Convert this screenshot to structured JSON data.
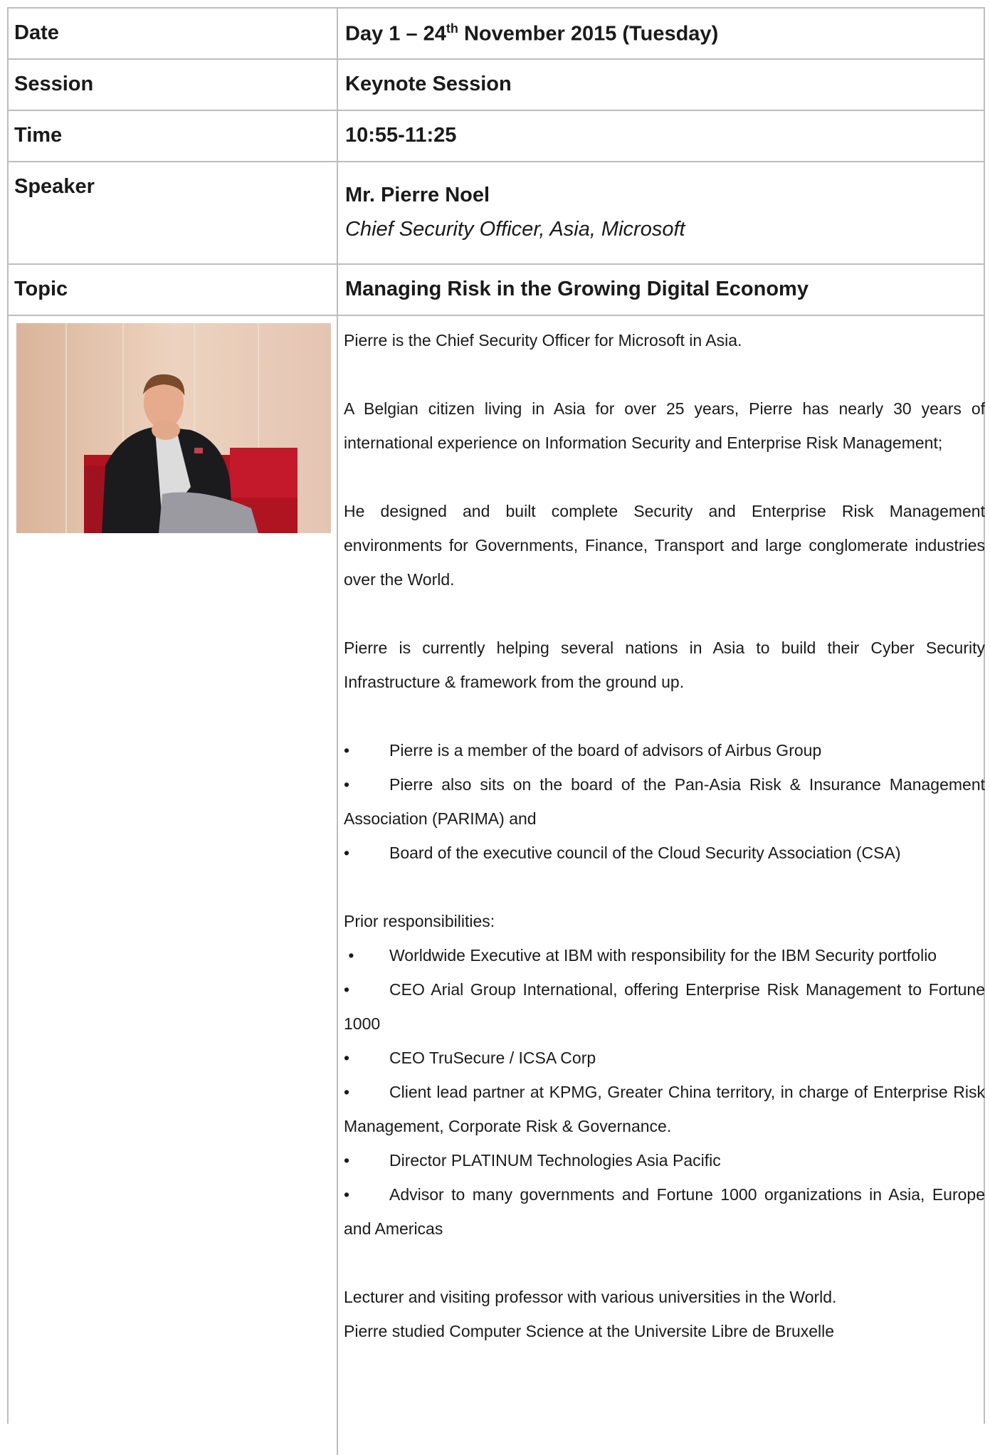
{
  "date": {
    "label": "Date",
    "value_pre": "Day 1 – 24",
    "value_sup": "th",
    "value_post": " November 2015 (Tuesday)"
  },
  "session": {
    "label": "Session",
    "value": "Keynote Session"
  },
  "time": {
    "label": "Time",
    "value": "10:55-11:25"
  },
  "speaker": {
    "label": "Speaker",
    "name": "Mr. Pierre Noel",
    "title": "Chief Security Officer, Asia, Microsoft"
  },
  "topic": {
    "label": "Topic",
    "value": "Managing Risk in the Growing Digital Economy"
  },
  "bio": {
    "p1": "Pierre is the Chief Security Officer for Microsoft in Asia.",
    "p2": "A Belgian citizen living in Asia for over 25 years, Pierre has nearly 30 years of international experience on Information Security and Enterprise Risk Management;",
    "p3": "He designed and built complete Security and Enterprise Risk Management environments for Governments, Finance, Transport and large conglomerate industries over the World.",
    "p4": "Pierre is currently helping several nations in Asia to build their Cyber Security Infrastructure & framework from the ground up.",
    "roles": [
      "Pierre is a member of the board of advisors of Airbus Group",
      "Pierre also sits on the board of the Pan-Asia Risk & Insurance Management Association (PARIMA) and",
      "Board of the executive council of the Cloud Security Association (CSA)"
    ],
    "prior_heading": "Prior responsibilities:",
    "prior": [
      "Worldwide Executive at IBM with responsibility for the IBM Security portfolio",
      "CEO Arial Group International, offering Enterprise Risk Management to Fortune 1000",
      "CEO TruSecure / ICSA Corp",
      "Client lead partner at KPMG, Greater China territory, in charge of Enterprise Risk Management, Corporate Risk & Governance.",
      "Director PLATINUM Technologies Asia Pacific",
      "Advisor to many governments and Fortune 1000 organizations in Asia, Europe and Americas"
    ],
    "p5": "Lecturer and visiting professor with various universities in the World.",
    "p6": "Pierre studied Computer Science at the Universite Libre de Bruxelle"
  }
}
